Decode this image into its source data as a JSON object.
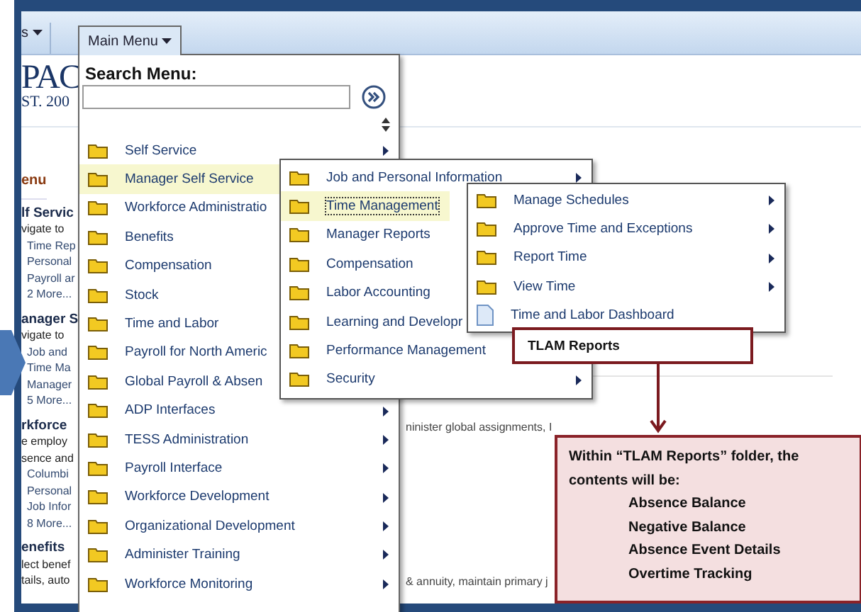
{
  "top_bar": {
    "tabs": [
      {
        "label": "s",
        "selected": false
      },
      {
        "label": "Main Menu",
        "selected": true
      }
    ]
  },
  "logo": {
    "line_1": "PAC",
    "line_2": "ST. 200"
  },
  "left_panel": {
    "title": "enu",
    "sections": [
      {
        "title": "lf Servic",
        "lines": [
          "vigate to"
        ],
        "links": [
          "Time Rep",
          "Personal",
          "Payroll ar"
        ],
        "more": "2 More..."
      },
      {
        "title": "anager S",
        "lines": [
          "vigate to"
        ],
        "links": [
          "Job and",
          "Time Ma",
          "Manager"
        ],
        "more": "5 More..."
      },
      {
        "title": "rkforce",
        "lines": [
          "e employ",
          "sence and"
        ],
        "links": [
          "Columbi",
          "Personal",
          "Job Infor"
        ],
        "more": "8 More..."
      },
      {
        "title": "enefits",
        "lines": [
          "lect benef",
          "tails, auto"
        ]
      }
    ]
  },
  "content": {
    "lines": [
      "ninister global assignments, I",
      "& annuity, maintain primary j"
    ]
  },
  "main_menu": {
    "search_label": "Search Menu:",
    "items": [
      {
        "label": "Self Service",
        "arrow": true,
        "selected": false
      },
      {
        "label": "Manager Self Service",
        "selected": true
      },
      {
        "label": "Workforce Administratio",
        "selected": false
      },
      {
        "label": "Benefits",
        "selected": false
      },
      {
        "label": "Compensation",
        "selected": false
      },
      {
        "label": "Stock",
        "selected": false
      },
      {
        "label": "Time and Labor",
        "selected": false
      },
      {
        "label": "Payroll for North Americ",
        "selected": false
      },
      {
        "label": "Global Payroll & Absen",
        "selected": false
      },
      {
        "label": "ADP Interfaces",
        "arrow": true,
        "selected": false
      },
      {
        "label": "TESS Administration",
        "arrow": true,
        "selected": false
      },
      {
        "label": "Payroll Interface",
        "arrow": true,
        "selected": false
      },
      {
        "label": "Workforce Development",
        "arrow": true,
        "selected": false
      },
      {
        "label": "Organizational Development",
        "arrow": true,
        "selected": false
      },
      {
        "label": "Administer Training",
        "arrow": true,
        "selected": false
      },
      {
        "label": "Workforce Monitoring",
        "arrow": true,
        "selected": false
      }
    ]
  },
  "submenu_1": {
    "items": [
      {
        "label": "Job and Personal Information",
        "arrow": true,
        "selected": false
      },
      {
        "label": "Time Management",
        "selected": true
      },
      {
        "label": "Manager Reports",
        "selected": false
      },
      {
        "label": "Compensation",
        "selected": false
      },
      {
        "label": "Labor Accounting",
        "selected": false
      },
      {
        "label": "Learning and Developr",
        "selected": false
      },
      {
        "label": "Performance Management",
        "selected": false
      },
      {
        "label": "Security",
        "arrow": true,
        "selected": false
      }
    ]
  },
  "submenu_2": {
    "items": [
      {
        "label": "Manage Schedules",
        "kind": "folder",
        "arrow": true
      },
      {
        "label": "Approve Time and Exceptions",
        "kind": "folder",
        "arrow": true
      },
      {
        "label": "Report Time",
        "kind": "folder",
        "arrow": true
      },
      {
        "label": "View Time",
        "kind": "folder",
        "arrow": true
      },
      {
        "label": "Time and Labor Dashboard",
        "kind": "document"
      }
    ]
  },
  "highlight": {
    "label": "TLAM Reports"
  },
  "callout": {
    "text": "Within “TLAM Reports” folder, the contents will be:",
    "items": [
      "Absence Balance",
      "Negative Balance",
      "Absence Event Details",
      "Overtime Tracking"
    ]
  }
}
